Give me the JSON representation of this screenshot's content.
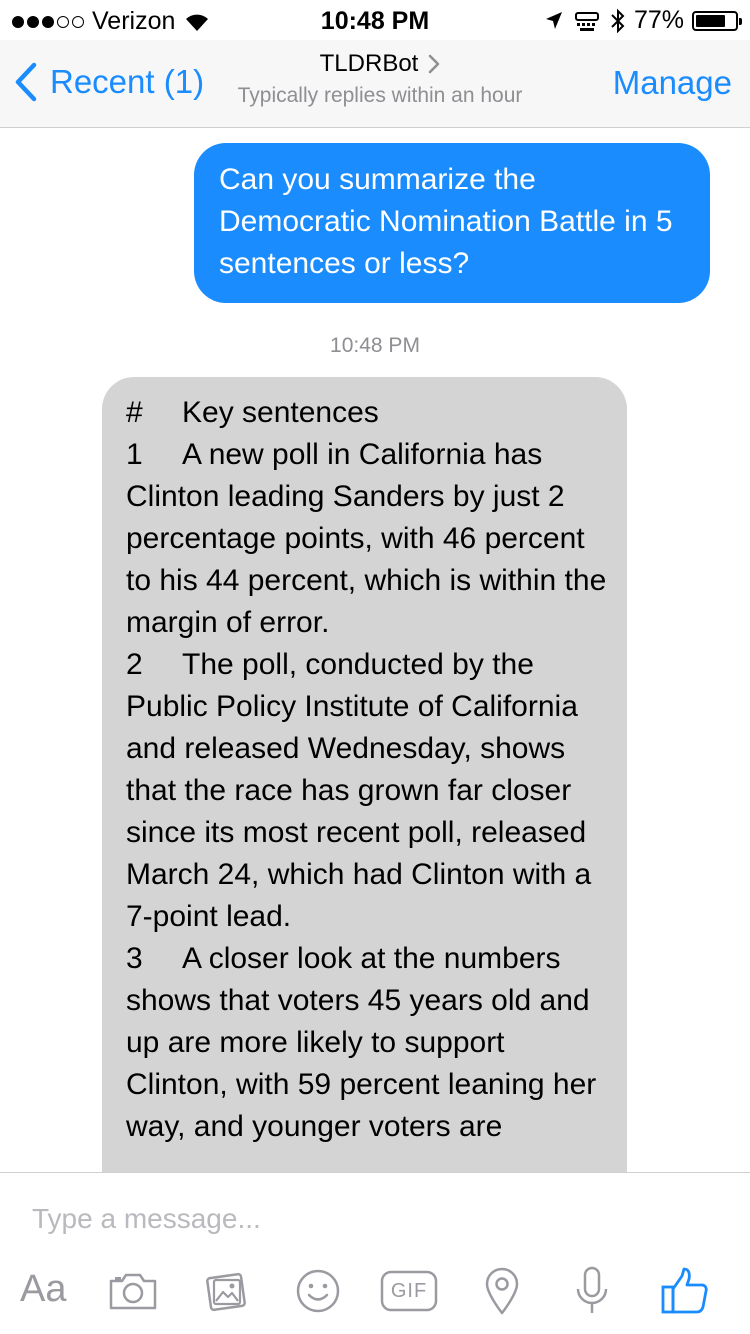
{
  "status_bar": {
    "carrier": "Verizon",
    "time": "10:48 PM",
    "battery_percent": "77%",
    "battery_level": 0.77,
    "signal_bars": 3
  },
  "nav": {
    "back_label": "Recent (1)",
    "title": "TLDRBot",
    "subtitle": "Typically replies within an hour",
    "manage_label": "Manage"
  },
  "messages": {
    "outgoing": "Can you summarize the Democratic Nomination Battle in 5 sentences or less?",
    "timestamp": "10:48 PM",
    "incoming": {
      "header_num": "#",
      "header_text": "Key sentences",
      "s1_num": "1",
      "s1_line1": "A new poll in California has",
      "s1_rest": "Clinton leading Sanders by just 2 percentage points, with 46 percent to his 44 percent, which is within the margin of error.",
      "s2_num": "2",
      "s2_line1": "The poll, conducted by the",
      "s2_rest": "Public Policy Institute of California and released Wednesday, shows that the race has grown far closer since its most recent poll, released March 24, which had Clinton with a 7-point lead.",
      "s3_num": "3",
      "s3_line1": "A closer look at the numbers",
      "s3_rest": "shows that voters 45 years old and up are more likely to support Clinton, with 59 percent leaning her way, and younger voters are"
    }
  },
  "composer": {
    "placeholder": "Type a message...",
    "aa_label": "Aa",
    "gif_label": "GIF"
  },
  "colors": {
    "accent": "#1a8cfe",
    "incoming_bubble": "#d4d4d4",
    "secondary_text": "#8e8e93",
    "icon_gray": "#9a9aa0"
  }
}
